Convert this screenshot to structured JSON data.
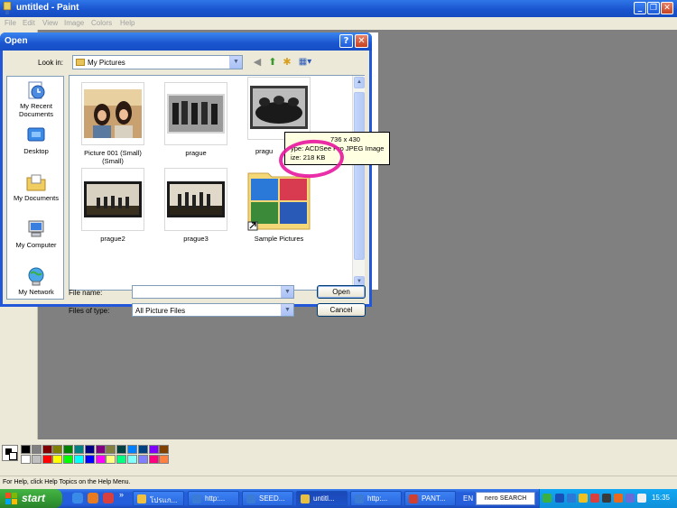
{
  "paint_window": {
    "title": "untitled - Paint",
    "menu": [
      "File",
      "Edit",
      "View",
      "Image",
      "Colors",
      "Help"
    ],
    "status_text": "For Help, click Help Topics on the Help Menu."
  },
  "palette": {
    "row1": [
      "#000000",
      "#808080",
      "#800000",
      "#808000",
      "#008000",
      "#008080",
      "#000080",
      "#800080",
      "#808040",
      "#004040",
      "#0080ff",
      "#004080",
      "#8000ff",
      "#804000"
    ],
    "row2": [
      "#ffffff",
      "#c0c0c0",
      "#ff0000",
      "#ffff00",
      "#00ff00",
      "#00ffff",
      "#0000ff",
      "#ff00ff",
      "#ffff80",
      "#00ff80",
      "#80ffff",
      "#8080ff",
      "#ff0080",
      "#ff8040"
    ]
  },
  "dialog": {
    "title": "Open",
    "help_button": "?",
    "close_button": "✕",
    "look_in_label": "Look in:",
    "look_in_value": "My Pictures",
    "places": [
      {
        "label": "My Recent Documents",
        "icon": "recent-documents-icon"
      },
      {
        "label": "Desktop",
        "icon": "desktop-icon"
      },
      {
        "label": "My Documents",
        "icon": "my-documents-icon"
      },
      {
        "label": "My Computer",
        "icon": "my-computer-icon"
      },
      {
        "label": "My Network",
        "icon": "my-network-icon"
      }
    ],
    "files": [
      {
        "name": "Picture 001 (Small)\n(Small)",
        "line1": "Picture 001 (Small)",
        "line2": "(Small)"
      },
      {
        "name": "prague",
        "line1": "prague",
        "line2": ""
      },
      {
        "name": "prague1",
        "line1": "pragu",
        "line2": ""
      },
      {
        "name": "prague2",
        "line1": "prague2",
        "line2": ""
      },
      {
        "name": "prague3",
        "line1": "prague3",
        "line2": ""
      },
      {
        "name": "Sample Pictures",
        "line1": "Sample Pictures",
        "line2": ""
      }
    ],
    "tooltip": {
      "line1": "736 x 430",
      "line2": "ype: ACDSee Pro JPEG Image",
      "line3": "ize: 218 KB"
    },
    "file_name_label": "File name:",
    "file_name_value": "",
    "files_of_type_label": "Files of type:",
    "files_of_type_value": "All Picture Files",
    "open_button": "Open",
    "cancel_button": "Cancel"
  },
  "taskbar": {
    "start_label": "start",
    "overflow": "»",
    "tasks": [
      {
        "label": "โปรแก...",
        "icon_color": "#f0c040"
      },
      {
        "label": "http:...",
        "icon_color": "#3a7bd5"
      },
      {
        "label": "SEED...",
        "icon_color": "#3a7bd5"
      },
      {
        "label": "untitl...",
        "icon_color": "#e8c040"
      },
      {
        "label": "http:...",
        "icon_color": "#3a7bd5"
      },
      {
        "label": "PANT...",
        "icon_color": "#d04030"
      }
    ],
    "language": "EN",
    "nero_search": "nero SEARCH",
    "clock": "15:35"
  }
}
